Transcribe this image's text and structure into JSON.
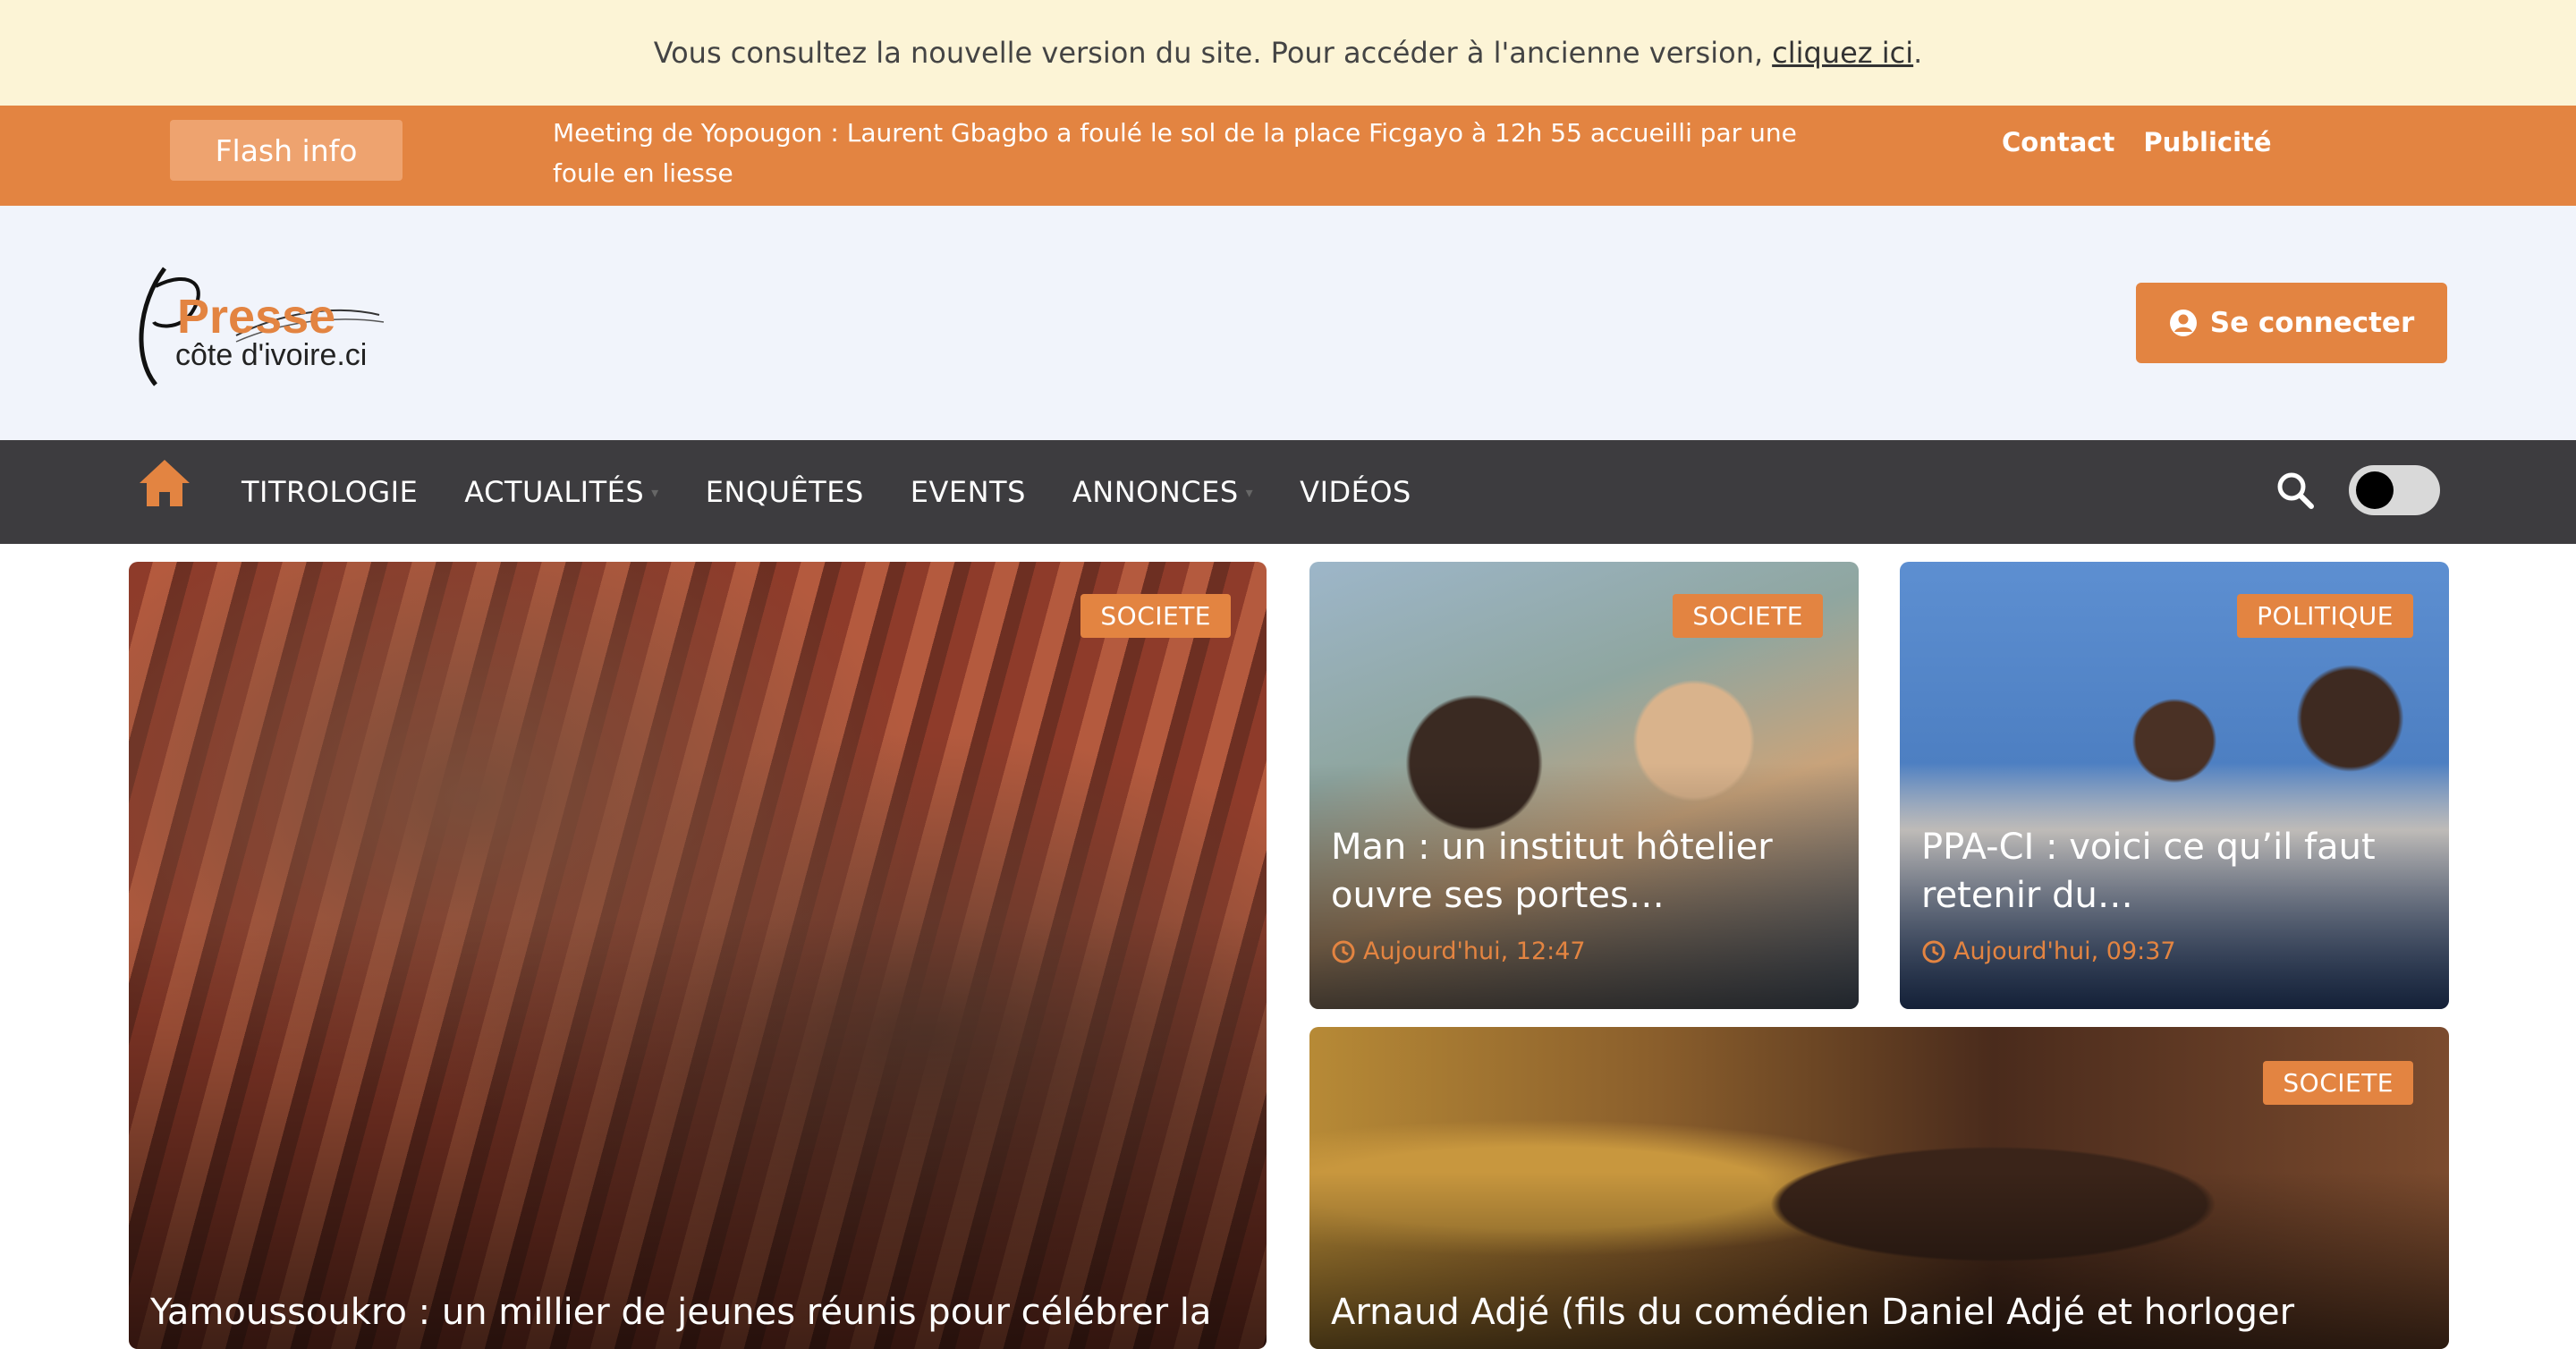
{
  "notice": {
    "text": "Vous consultez la nouvelle version du site. Pour accéder à l'ancienne version,",
    "link": "cliquez ici",
    "suffix": "."
  },
  "flash": {
    "button": "Flash info",
    "headline": "Meeting de Yopougon : Laurent Gbagbo a foulé le sol de la place Ficgayo à 12h 55 accueilli par une foule en liesse",
    "links": [
      "Contact",
      "Publicité"
    ]
  },
  "header": {
    "logo_text_top": "Presse",
    "logo_text_bottom": "côte d'ivoire.ci",
    "login_label": "Se connecter"
  },
  "nav": {
    "items": [
      "TITROLOGIE",
      "ACTUALITÉS",
      "ENQUÊTES",
      "EVENTS",
      "ANNONCES",
      "VIDÉOS"
    ]
  },
  "cards": {
    "main": {
      "category": "SOCIETE",
      "title": "Yamoussoukro : un millier de jeunes réunis pour célébrer la"
    },
    "card1": {
      "category": "SOCIETE",
      "title": "Man : un institut hôtelier ouvre ses portes…",
      "time": "Aujourd'hui, 12:47"
    },
    "card2": {
      "category": "POLITIQUE",
      "title": "PPA-CI : voici ce qu’il faut retenir du…",
      "time": "Aujourd'hui, 09:37"
    },
    "card3": {
      "category": "SOCIETE",
      "title": "Arnaud Adjé (fils du comédien Daniel Adjé et horloger"
    }
  },
  "colors": {
    "accent": "#e38441",
    "nav_bg": "#3d3c3f",
    "notice_bg": "#fcf4d6"
  }
}
